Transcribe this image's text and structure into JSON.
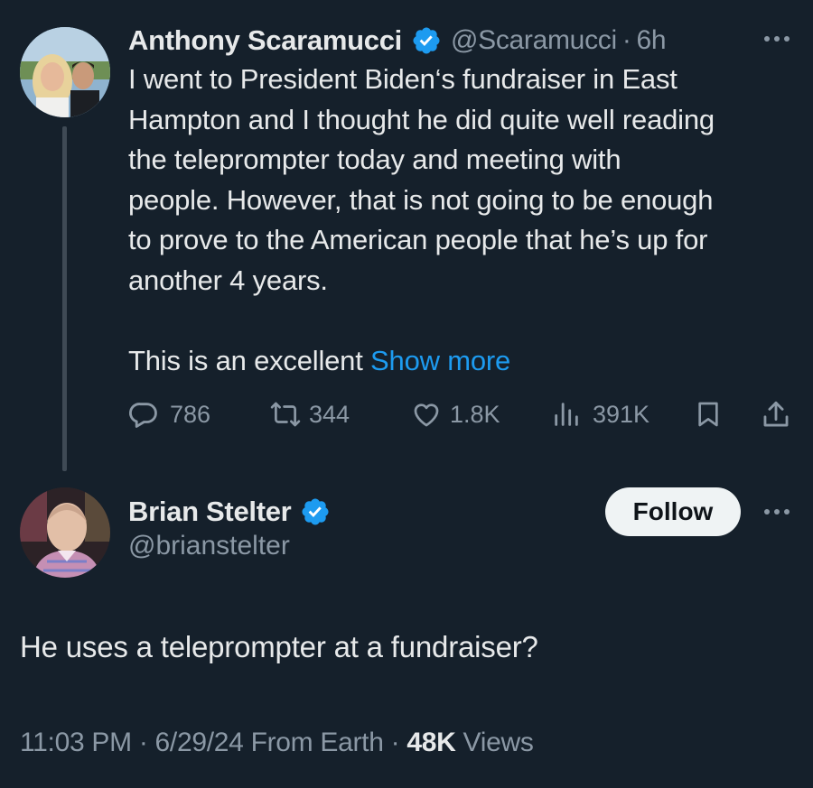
{
  "parent_tweet": {
    "author_name": "Anthony Scaramucci",
    "handle": "@Scaramucci",
    "separator": "·",
    "time_ago": "6h",
    "text_lines": [
      "I went to President Biden‘s fundraiser in East",
      "Hampton and I thought he did quite well reading",
      "the teleprompter today and meeting with",
      "people. However, that is not going to be enough",
      "to prove to the American people that he’s up for",
      "another 4 years."
    ],
    "text_tail": "This is an excellent ",
    "show_more_label": "Show more",
    "stats": {
      "replies": "786",
      "reposts": "344",
      "likes": "1.8K",
      "views": "391K"
    }
  },
  "reply_tweet": {
    "author_name": "Brian Stelter",
    "handle": "@brianstelter",
    "follow_label": "Follow",
    "text": "He uses a teleprompter at a fundraiser?",
    "timestamp": "11:03 PM · 6/29/24 From Earth · ",
    "views_count": "48K",
    "views_label": " Views"
  },
  "icons": {
    "verified": "verified-badge-icon",
    "more": "more-dots-icon",
    "reply": "reply-bubble-icon",
    "repost": "repost-icon",
    "like": "heart-icon",
    "views": "bar-chart-icon",
    "bookmark": "bookmark-icon",
    "share": "share-icon"
  },
  "colors": {
    "background": "#15202b",
    "accent": "#1d9bf0",
    "text_primary": "#e7e9ea",
    "text_secondary": "#8b98a5",
    "follow_button_bg": "#eff3f4"
  }
}
